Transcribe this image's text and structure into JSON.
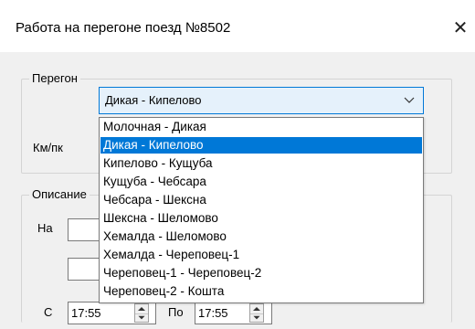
{
  "window": {
    "title": "Работа на перегоне поезд №8502",
    "close_icon": "close-icon"
  },
  "stretch_group": {
    "legend": "Перегон",
    "combo_value": "Дикая - Кипелово",
    "km_label": "Км/пк"
  },
  "dropdown": {
    "options": [
      "Молочная - Дикая",
      "Дикая - Кипелово",
      "Кипелово - Кущуба",
      "Кущуба - Чебсара",
      "Чебсара - Шексна",
      "Шексна - Шеломово",
      "Хемалда - Шеломово",
      "Хемалда - Череповец-1",
      "Череповец-1 - Череповец-2",
      "Череповец-2 - Кошта"
    ],
    "selected_index": 1
  },
  "description_group": {
    "legend": "Описание",
    "on_label": "На"
  },
  "time_row": {
    "from_label": "С",
    "from_value": "17:55",
    "to_label": "По",
    "to_value": "17:55"
  },
  "colors": {
    "accent": "#0078d7",
    "dialog_bg": "#f0f0f0",
    "combo_bg": "#e5f1fb"
  }
}
